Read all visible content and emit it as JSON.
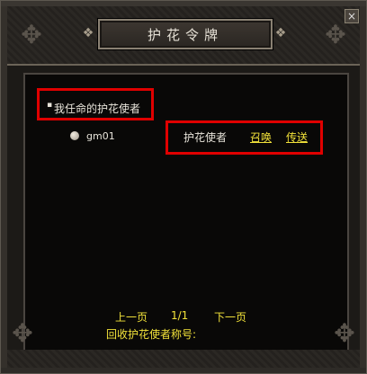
{
  "window": {
    "title": "护花令牌",
    "close_label": "×"
  },
  "list": {
    "header_bullet": "▪",
    "header": "我任命的护花使者",
    "items": [
      {
        "name": "gm01"
      }
    ]
  },
  "actions": {
    "role_label": "护花使者",
    "summon_label": "召唤",
    "teleport_label": "传送"
  },
  "pagination": {
    "prev_label": "上一页",
    "page_indicator": "1/1",
    "next_label": "下一页"
  },
  "recall": {
    "label": "回收护花使者称号:"
  },
  "colors": {
    "highlight_box": "#e00000",
    "link_yellow": "#f2e23a"
  }
}
